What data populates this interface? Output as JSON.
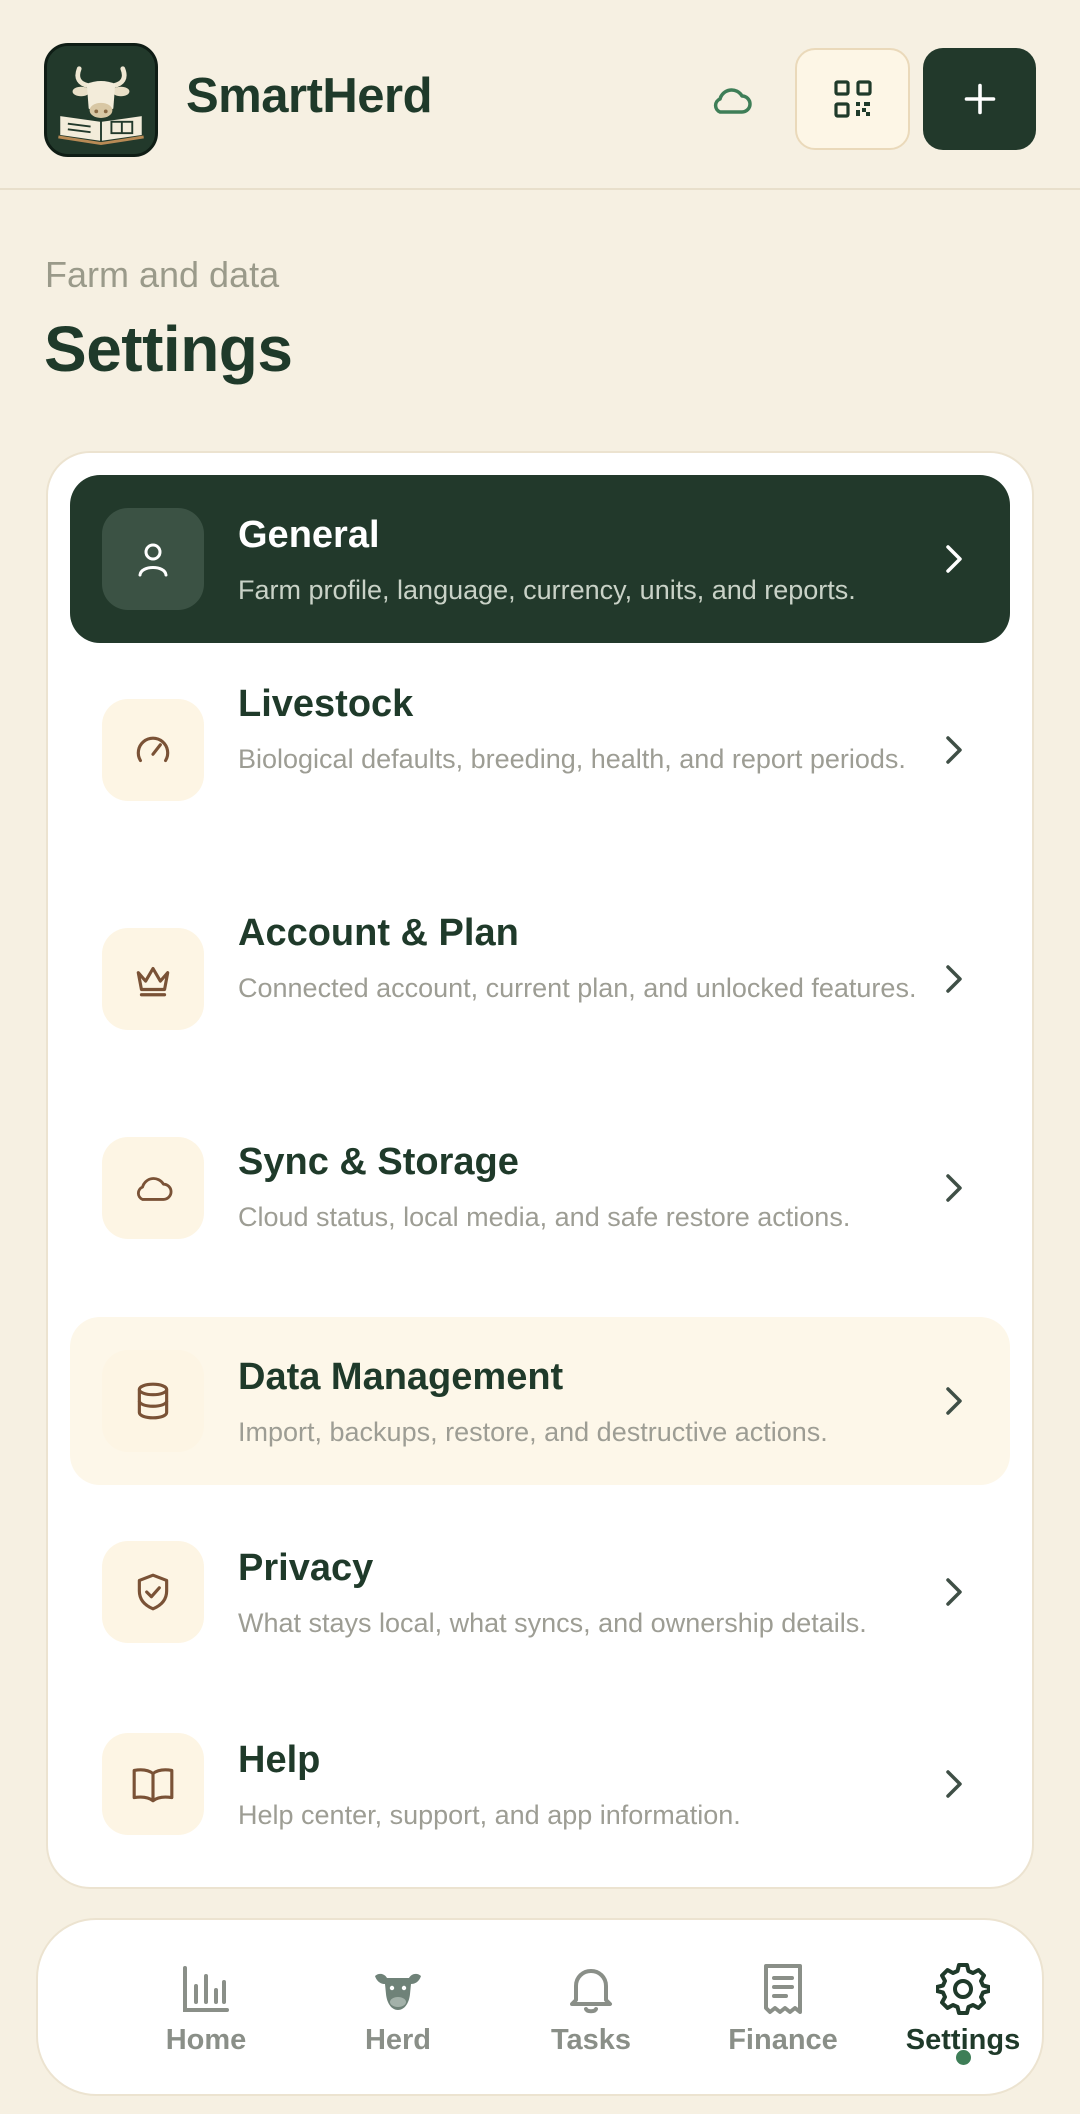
{
  "header": {
    "brand": "SmartHerd",
    "icons": {
      "logo": "cow-book-logo",
      "status": "cloud-icon",
      "scan": "qr-code-icon",
      "add": "plus-icon"
    }
  },
  "page": {
    "eyebrow": "Farm and data",
    "title": "Settings"
  },
  "settings": {
    "items": [
      {
        "title": "General",
        "description": "Farm profile, language, currency, units, and reports.",
        "icon": "user-icon",
        "state": "active"
      },
      {
        "title": "Livestock",
        "description": "Biological defaults, breeding, health, and report periods.",
        "icon": "gauge-icon",
        "state": "normal"
      },
      {
        "title": "Account & Plan",
        "description": "Connected account, current plan, and unlocked features.",
        "icon": "crown-icon",
        "state": "normal"
      },
      {
        "title": "Sync & Storage",
        "description": "Cloud status, local media, and safe restore actions.",
        "icon": "cloud-icon",
        "state": "normal"
      },
      {
        "title": "Data Management",
        "description": "Import, backups, restore, and destructive actions.",
        "icon": "database-icon",
        "state": "highlight"
      },
      {
        "title": "Privacy",
        "description": "What stays local, what syncs, and ownership details.",
        "icon": "shield-check-icon",
        "state": "normal"
      },
      {
        "title": "Help",
        "description": "Help center, support, and app information.",
        "icon": "book-icon",
        "state": "normal"
      }
    ]
  },
  "nav": {
    "tabs": [
      {
        "label": "Home",
        "icon": "bar-chart-icon"
      },
      {
        "label": "Herd",
        "icon": "cow-icon"
      },
      {
        "label": "Tasks",
        "icon": "bell-icon"
      },
      {
        "label": "Finance",
        "icon": "receipt-icon"
      },
      {
        "label": "Settings",
        "icon": "gear-icon",
        "active": true
      }
    ]
  },
  "colors": {
    "background": "#f6f0e2",
    "primary": "#22392b",
    "card": "#ffffff",
    "icon_tile": "#fdf5e4",
    "icon_brown": "#7a5236",
    "muted_text": "#9d9d94",
    "accent_green": "#3e7e57"
  }
}
